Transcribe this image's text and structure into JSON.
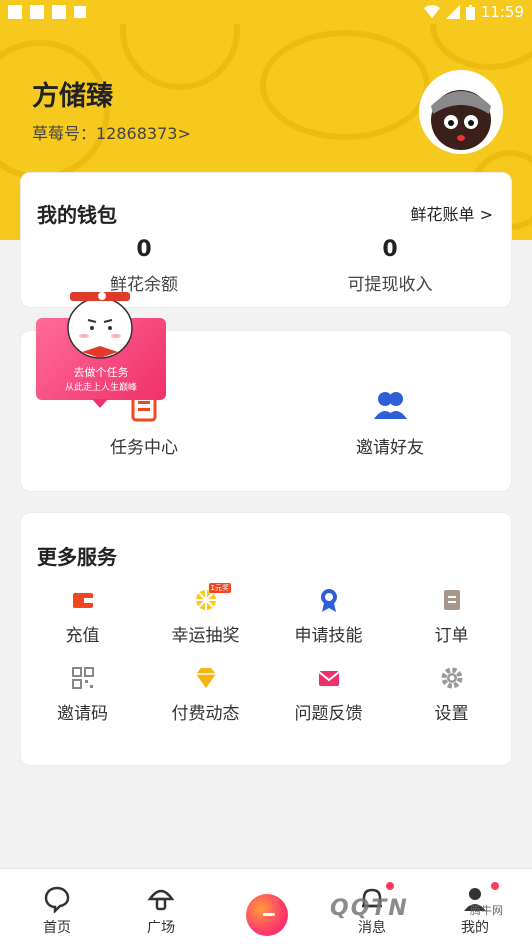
{
  "status_bar": {
    "time": "11:59"
  },
  "profile": {
    "name": "方储臻",
    "id_text": "草莓号：12868373>"
  },
  "wallet": {
    "title": "我的钱包",
    "link": "鲜花账单 >",
    "left": {
      "value": "0",
      "label": "鲜花余额"
    },
    "right": {
      "value": "0",
      "label": "可提现收入"
    }
  },
  "promo": {
    "line1": "去做个任务",
    "line2": "从此走上人生巅峰"
  },
  "tasks": [
    {
      "label": "任务中心",
      "icon": "clipboard-icon"
    },
    {
      "label": "邀请好友",
      "icon": "users-icon"
    }
  ],
  "more_services": {
    "title": "更多服务",
    "items": [
      {
        "label": "充值",
        "icon": "wallet-icon",
        "color": "#f2461f"
      },
      {
        "label": "幸运抽奖",
        "icon": "lottery-wheel-icon",
        "color": "#f5c91e"
      },
      {
        "label": "申请技能",
        "icon": "medal-icon",
        "color": "#2f5fd6"
      },
      {
        "label": "订单",
        "icon": "receipt-icon",
        "color": "#a7968b"
      },
      {
        "label": "邀请码",
        "icon": "qrcode-icon",
        "color": "#888888"
      },
      {
        "label": "付费动态",
        "icon": "diamond-icon",
        "color": "#f5b50e"
      },
      {
        "label": "问题反馈",
        "icon": "mail-icon",
        "color": "#f0306a"
      },
      {
        "label": "设置",
        "icon": "gear-icon",
        "color": "#9a9a9a"
      }
    ],
    "lottery_badge": "1元奖"
  },
  "bottom_nav": [
    {
      "label": "首页",
      "icon": "chat-bubble-icon"
    },
    {
      "label": "广场",
      "icon": "mushroom-icon"
    },
    {
      "label": "",
      "icon": "create-button"
    },
    {
      "label": "消息",
      "icon": "bell-icon"
    },
    {
      "label": "我的",
      "icon": "person-icon"
    }
  ],
  "watermark": {
    "text": "QQTN",
    "small": "腾牛网"
  },
  "colors": {
    "brand_yellow": "#f5c91e",
    "accent_pink": "#f0306a",
    "accent_blue": "#2f5fd6"
  }
}
